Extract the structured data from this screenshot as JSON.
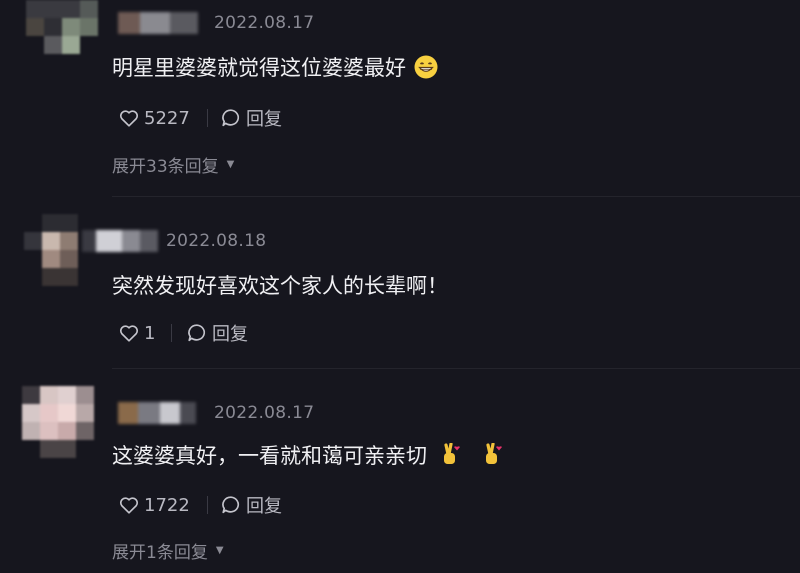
{
  "comments": [
    {
      "date": "2022.08.17",
      "text": "明星里婆婆就觉得这位婆婆最好",
      "emoji": "grinning-face",
      "likes": "5227",
      "reply_label": "回复",
      "expand_label": "展开33条回复"
    },
    {
      "date": "2022.08.18",
      "text": "突然发现好喜欢这个家人的长辈啊！",
      "likes": "1",
      "reply_label": "回复"
    },
    {
      "date": "2022.08.17",
      "text": "这婆婆真好，一看就和蔼可亲亲切",
      "emoji": "crossed-fingers-heart x2",
      "likes": "1722",
      "reply_label": "回复",
      "expand_label": "展开1条回复"
    }
  ],
  "colors": {
    "background": "#16161e",
    "text": "#f0f0f3",
    "secondary": "#8a8a94"
  }
}
